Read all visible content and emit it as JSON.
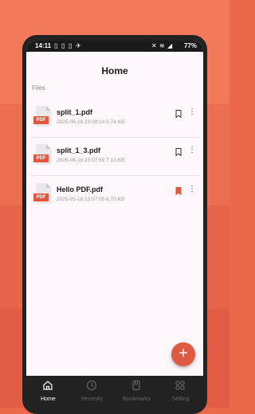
{
  "status_bar": {
    "time": "14:11",
    "battery": "77%"
  },
  "header": {
    "title": "Home"
  },
  "section": {
    "label": "Files"
  },
  "files": [
    {
      "name": "split_1.pdf",
      "meta": "2025-05-18 23:08:14 5.74 KB",
      "bookmarked": false,
      "icon_tag": "PDF"
    },
    {
      "name": "split_1_3.pdf",
      "meta": "2025-05-18 23:07:59 7.13 KB",
      "bookmarked": false,
      "icon_tag": "PDF"
    },
    {
      "name": "Hello PDF.pdf",
      "meta": "2025-05-18 23:07:05 6.70 KB",
      "bookmarked": true,
      "icon_tag": "PDF"
    }
  ],
  "fab": {
    "label": "+"
  },
  "nav": {
    "items": [
      {
        "label": "Home",
        "icon": "home-icon",
        "active": true
      },
      {
        "label": "Recently",
        "icon": "clock-icon",
        "active": false
      },
      {
        "label": "Bookmarks",
        "icon": "bookmark-icon",
        "active": false
      },
      {
        "label": "Setting",
        "icon": "grid-icon",
        "active": false
      }
    ]
  },
  "colors": {
    "accent": "#e05a42",
    "background": "#fdf6fb",
    "nav_bg": "#222222"
  }
}
